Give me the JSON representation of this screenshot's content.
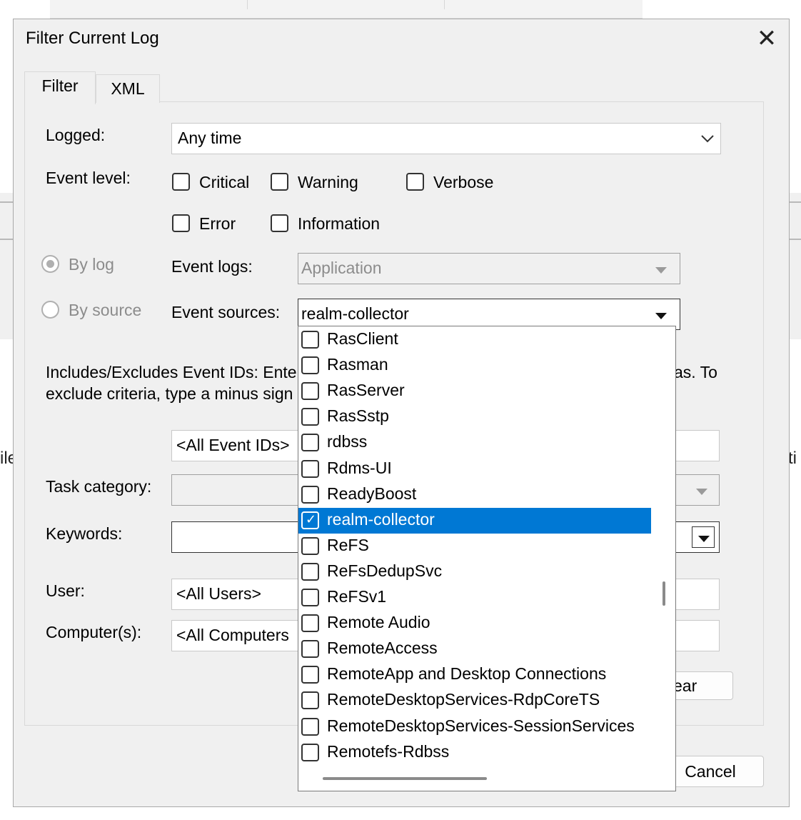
{
  "background": {
    "left_text": "ile",
    "right_text": "ti"
  },
  "dialog": {
    "title": "Filter Current Log",
    "close_glyph": "✕",
    "tabs": [
      {
        "label": "Filter"
      },
      {
        "label": "XML"
      }
    ]
  },
  "filter": {
    "logged_label": "Logged:",
    "logged_value": "Any time",
    "event_level_label": "Event level:",
    "levels": {
      "critical": "Critical",
      "warning": "Warning",
      "verbose": "Verbose",
      "error": "Error",
      "information": "Information"
    },
    "by_log": "By log",
    "by_source": "By source",
    "event_logs_label": "Event logs:",
    "event_logs_value": "Application",
    "event_sources_label": "Event sources:",
    "event_sources_value": "realm-collector",
    "ids_help_line1_left": "Includes/Excludes Event IDs: Enter",
    "ids_help_line1_right": "as. To",
    "ids_help_line2_left": "exclude criteria, type a minus sign",
    "event_ids_value": "<All Event IDs>",
    "task_category_label": "Task category:",
    "keywords_label": "Keywords:",
    "user_label": "User:",
    "user_value": "<All Users>",
    "computers_label": "Computer(s):",
    "computers_value": "<All Computers",
    "clear_button": "ear",
    "cancel_button": "Cancel"
  },
  "sources_list": [
    {
      "label": "RasClient",
      "checked": false
    },
    {
      "label": "Rasman",
      "checked": false
    },
    {
      "label": "RasServer",
      "checked": false
    },
    {
      "label": "RasSstp",
      "checked": false
    },
    {
      "label": "rdbss",
      "checked": false
    },
    {
      "label": "Rdms-UI",
      "checked": false
    },
    {
      "label": "ReadyBoost",
      "checked": false
    },
    {
      "label": "realm-collector",
      "checked": true
    },
    {
      "label": "ReFS",
      "checked": false
    },
    {
      "label": "ReFsDedupSvc",
      "checked": false
    },
    {
      "label": "ReFSv1",
      "checked": false
    },
    {
      "label": "Remote Audio",
      "checked": false
    },
    {
      "label": "RemoteAccess",
      "checked": false
    },
    {
      "label": "RemoteApp and Desktop Connections",
      "checked": false
    },
    {
      "label": "RemoteDesktopServices-RdpCoreTS",
      "checked": false
    },
    {
      "label": "RemoteDesktopServices-SessionServices",
      "checked": false
    },
    {
      "label": "Remotefs-Rdbss",
      "checked": false
    }
  ],
  "colors": {
    "selection": "#0078d4",
    "dialog_bg": "#f0f0f0"
  }
}
